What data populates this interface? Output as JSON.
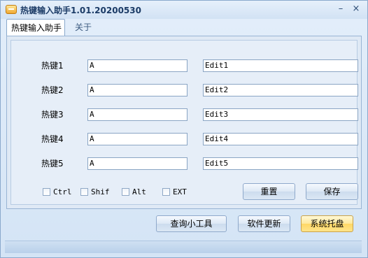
{
  "window": {
    "title": "热键输入助手1.01.20200530",
    "minimize_glyph": "–",
    "close_glyph": "×"
  },
  "tabs": [
    {
      "label": "热键输入助手",
      "active": true
    },
    {
      "label": "关于",
      "active": false
    }
  ],
  "hotkeys": [
    {
      "label": "热键1",
      "key": "A",
      "text": "Edit1"
    },
    {
      "label": "热键2",
      "key": "A",
      "text": "Edit2"
    },
    {
      "label": "热键3",
      "key": "A",
      "text": "Edit3"
    },
    {
      "label": "热键4",
      "key": "A",
      "text": "Edit4"
    },
    {
      "label": "热键5",
      "key": "A",
      "text": "Edit5"
    }
  ],
  "modifiers": [
    {
      "label": "Ctrl",
      "checked": false
    },
    {
      "label": "Shif",
      "checked": false
    },
    {
      "label": "Alt",
      "checked": false
    },
    {
      "label": "EXT",
      "checked": false
    }
  ],
  "buttons": {
    "reset": "重置",
    "save": "保存",
    "query_tool": "查询小工具",
    "update": "软件更新",
    "tray": "系统托盘"
  },
  "colors": {
    "accent_tray": "#ffe48a",
    "window_bg": "#d6e6f6"
  }
}
